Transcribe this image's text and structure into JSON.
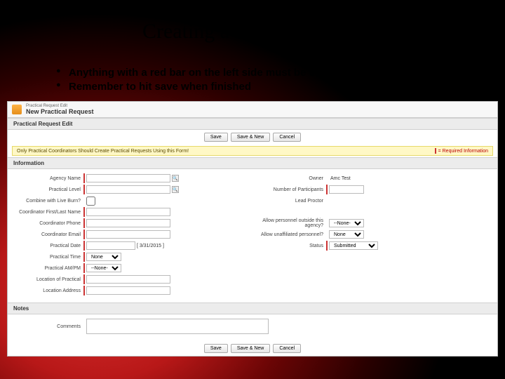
{
  "slide": {
    "title": "Creating a Practical Exam",
    "bullets": [
      "Anything with a red bar on the left side must be completed",
      "Remember to hit save when finished"
    ]
  },
  "app": {
    "header_sub": "Practical Request Edit",
    "header_title": "New Practical Request",
    "section_edit": "Practical Request Edit",
    "warn_text": "Only Practical Coordinators Should Create Practical Requests Using this Form!",
    "required_note": "= Required Information",
    "section_info": "Information",
    "section_notes": "Notes",
    "buttons": {
      "save": "Save",
      "save_new": "Save & New",
      "cancel": "Cancel"
    }
  },
  "fields_left": {
    "agency_name": {
      "label": "Agency Name",
      "value": ""
    },
    "practical_level": {
      "label": "Practical Level",
      "value": ""
    },
    "combine_live_burn": {
      "label": "Combine with Live Burn?",
      "checked": false
    },
    "coord_first_last": {
      "label": "Coordinator First/Last Name",
      "value": ""
    },
    "coord_phone": {
      "label": "Coordinator Phone",
      "value": ""
    },
    "coord_email": {
      "label": "Coordinator Email",
      "value": ""
    },
    "practical_date": {
      "label": "Practical Date",
      "value": "",
      "hint": "[ 3/31/2015 ]"
    },
    "practical_time": {
      "label": "Practical Time",
      "value": "None"
    },
    "practical_ampm": {
      "label": "Practical AM/PM",
      "value": "--None--"
    },
    "location": {
      "label": "Location of Practical",
      "value": ""
    },
    "location_addr": {
      "label": "Location Address",
      "value": ""
    }
  },
  "fields_right": {
    "owner": {
      "label": "Owner",
      "value": "Amc Test"
    },
    "num_participants": {
      "label": "Number of Participants",
      "value": ""
    },
    "lead_proctor": {
      "label": "Lead Proctor",
      "value": ""
    },
    "allow_outside": {
      "label": "Allow personnel outside this agency?",
      "value": "--None--"
    },
    "allow_unaffiliated": {
      "label": "Allow unaffiliated personnel?",
      "value": "None"
    },
    "status": {
      "label": "Status",
      "value": "Submitted"
    }
  },
  "notes": {
    "comments": {
      "label": "Comments",
      "value": ""
    }
  }
}
